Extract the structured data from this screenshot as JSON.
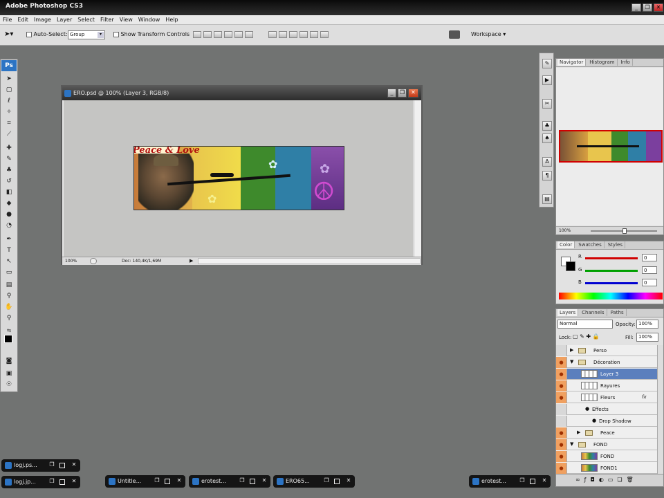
{
  "app": {
    "title": "Adobe Photoshop CS3"
  },
  "window_controls": {
    "minimize": "_",
    "restore": "❐",
    "close": "✕"
  },
  "menu": [
    "File",
    "Edit",
    "Image",
    "Layer",
    "Select",
    "Filter",
    "View",
    "Window",
    "Help"
  ],
  "options": {
    "auto_select_label": "Auto-Select:",
    "auto_select_value": "Group",
    "show_transform_label": "Show Transform Controls",
    "workspace_label": "Workspace ▾"
  },
  "toolbox": {
    "logo": "Ps"
  },
  "document": {
    "title": "ERO.psd @ 100% (Layer 3, RGB/8)",
    "zoom": "100%",
    "doc_info": "Doc: 140,4K/1,69M",
    "banner_text": "Peace & Love"
  },
  "navigator": {
    "tabs": [
      "Navigator",
      "Histogram",
      "Info"
    ],
    "zoom": "100%"
  },
  "color_panel": {
    "tabs": [
      "Color",
      "Swatches",
      "Styles"
    ],
    "channels": [
      {
        "label": "R",
        "value": "0",
        "color": "#d00000"
      },
      {
        "label": "G",
        "value": "0",
        "color": "#00a000"
      },
      {
        "label": "B",
        "value": "0",
        "color": "#0000d0"
      }
    ]
  },
  "layers_panel": {
    "tabs": [
      "Layers",
      "Channels",
      "Paths"
    ],
    "blend_mode": "Normal",
    "opacity_label": "Opacity:",
    "opacity": "100%",
    "lock_label": "Lock:",
    "fill_label": "Fill:",
    "fill": "100%",
    "layers": [
      {
        "name": "Perso",
        "indent": 0,
        "type": "group",
        "expanded": false,
        "eye": false
      },
      {
        "name": "Décoration",
        "indent": 0,
        "type": "group",
        "expanded": true,
        "eye": true
      },
      {
        "name": "Layer 3",
        "indent": 1,
        "type": "layer",
        "selected": true,
        "eye": true
      },
      {
        "name": "Rayures",
        "indent": 1,
        "type": "layer",
        "eye": true
      },
      {
        "name": "Fleurs",
        "indent": 1,
        "type": "layer",
        "eye": true,
        "fx": "fx"
      },
      {
        "name": "Effects",
        "indent": 2,
        "type": "effects",
        "eye": false
      },
      {
        "name": "Drop Shadow",
        "indent": 3,
        "type": "effect",
        "eye": false
      },
      {
        "name": "Peace",
        "indent": 1,
        "type": "group",
        "expanded": false,
        "eye": true
      },
      {
        "name": "FOND",
        "indent": 0,
        "type": "group",
        "expanded": true,
        "eye": true
      },
      {
        "name": "FOND",
        "indent": 1,
        "type": "layer",
        "eye": true
      },
      {
        "name": "FOND1",
        "indent": 1,
        "type": "layer",
        "eye": true
      }
    ]
  },
  "taskbar": [
    {
      "label": "logj.ps..."
    },
    {
      "label": "logj.jp..."
    },
    {
      "label": "Untitle..."
    },
    {
      "label": "erotest..."
    },
    {
      "label": "ERO65..."
    },
    {
      "label": "erotest..."
    }
  ],
  "colors": {
    "workspace_bg": "#717372",
    "selected_layer": "#5b7fbd",
    "eye_column": "#f0a060",
    "banner_stripes": [
      "#d89a3c",
      "#e4c84a",
      "#3d8a2a",
      "#2f7ea8",
      "#7b3f9e"
    ]
  }
}
